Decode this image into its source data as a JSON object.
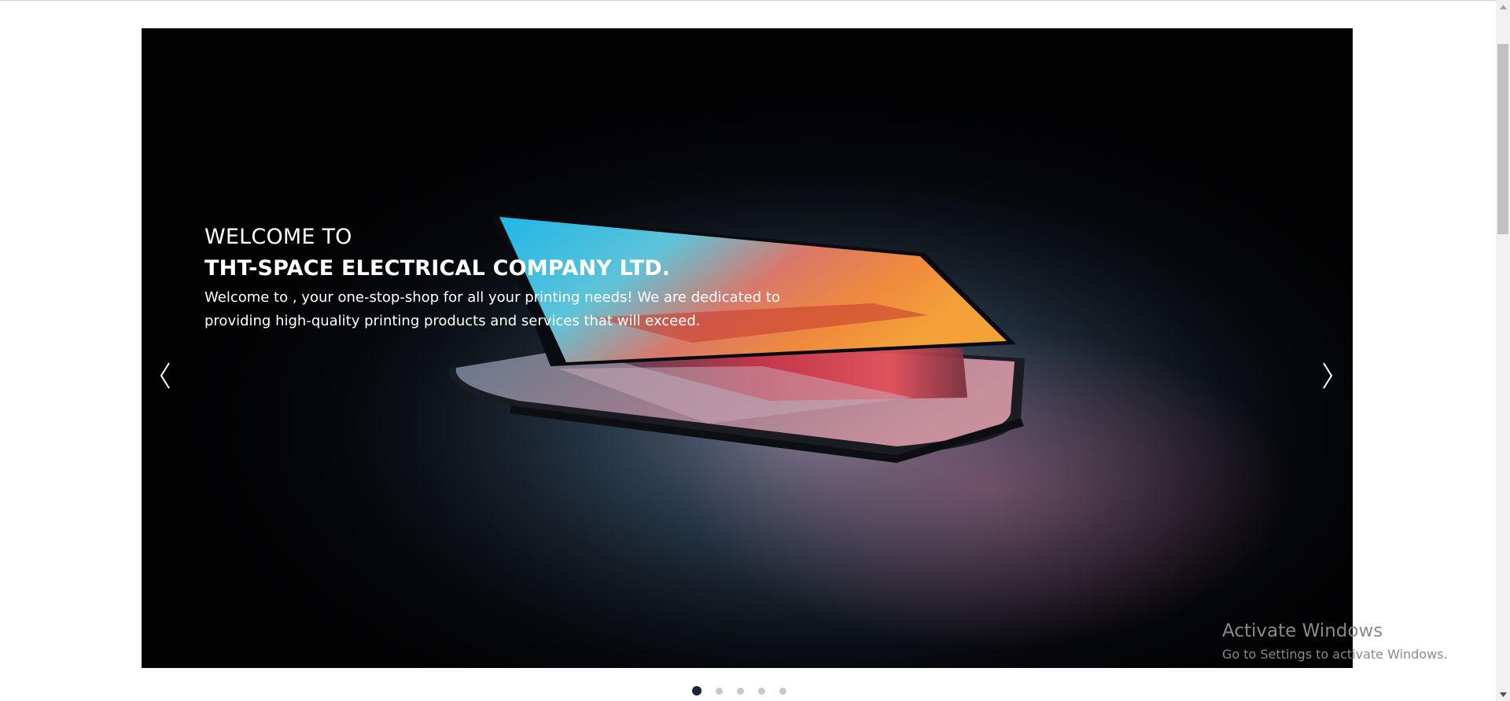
{
  "hero": {
    "heading_line1": "WELCOME TO",
    "heading_line2": "THT-SPACE ELECTRICAL COMPANY LTD.",
    "description": "Welcome to , your one-stop-shop for all your printing needs! We are dedicated to providing high-quality printing products and services that will exceed.",
    "prev_icon": "chevron-left-icon",
    "next_icon": "chevron-right-icon"
  },
  "pagination": {
    "total": 5,
    "active_index": 0
  },
  "watermark": {
    "title": "Activate Windows",
    "subtitle": "Go to Settings to activate Windows."
  },
  "colors": {
    "slide_bg": "#020203",
    "active_dot": "#1e2537",
    "inactive_dot": "#c8c8c8",
    "caption_text": "#ffffff"
  }
}
